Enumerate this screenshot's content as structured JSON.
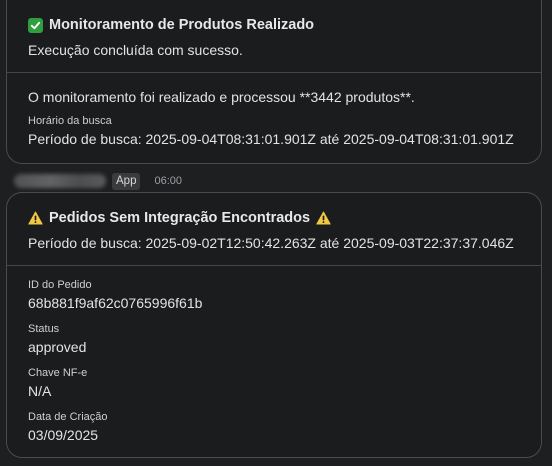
{
  "card1": {
    "title": "Monitoramento de Produtos Realizado",
    "subtitle": "Execução concluída com sucesso.",
    "message": "O monitoramento foi realizado e processou **3442 produtos**.",
    "field_label": "Horário da busca",
    "field_value": "Período de busca: 2025-09-04T08:31:01.901Z até 2025-09-04T08:31:01.901Z"
  },
  "sender": {
    "badge": "App",
    "time": "06:00"
  },
  "card2": {
    "title": "Pedidos Sem Integração Encontrados",
    "subtitle": "Período de busca: 2025-09-02T12:50:42.263Z até 2025-09-03T22:37:37.046Z",
    "fields": [
      {
        "label": "ID do Pedido",
        "value": "68b881f9af62c0765996f61b"
      },
      {
        "label": "Status",
        "value": "approved"
      },
      {
        "label": "Chave NF-e",
        "value": "N/A"
      },
      {
        "label": "Data de Criação",
        "value": "03/09/2025"
      }
    ]
  },
  "colors": {
    "background": "#1e1f20",
    "card": "#1b1c1d",
    "border": "#4a4b4d",
    "success": "#2e9e3f",
    "warning": "#f2c744"
  },
  "icons": [
    "check-icon",
    "warning-icon"
  ]
}
